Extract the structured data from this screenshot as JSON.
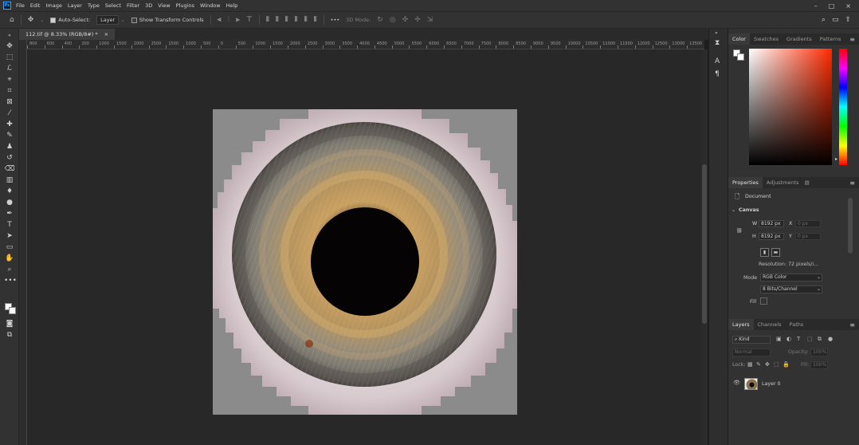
{
  "app": {
    "logo_text": "Ps"
  },
  "menu": [
    "File",
    "Edit",
    "Image",
    "Layer",
    "Type",
    "Select",
    "Filter",
    "3D",
    "View",
    "Plugins",
    "Window",
    "Help"
  ],
  "window_controls": {
    "minimize": "–",
    "maximize": "□",
    "close": "×"
  },
  "options_bar": {
    "auto_select_label": "Auto-Select:",
    "auto_select_checked": true,
    "auto_select_target": "Layer",
    "show_transform_label": "Show Transform Controls",
    "mode_3d_label": "3D Mode:",
    "more_label": "•••"
  },
  "document": {
    "tab_title": "112.tif @ 8.33% (RGB/8#) *",
    "close_glyph": "×"
  },
  "ruler": {
    "labels": [
      "800",
      "600",
      "400",
      "200",
      "1000",
      "1500",
      "2000",
      "2500",
      "1500",
      "1000",
      "500",
      "0",
      "500",
      "1000",
      "1500",
      "2000",
      "2500",
      "3000",
      "3500",
      "4000",
      "4500",
      "5000",
      "5500",
      "6000",
      "6500",
      "7000",
      "7500",
      "8000",
      "8500",
      "9000",
      "9500",
      "10000",
      "10500",
      "11000",
      "11500",
      "12000",
      "12500",
      "13000",
      "13500"
    ]
  },
  "color_panel": {
    "tabs": [
      "Color",
      "Swatches",
      "Gradients",
      "Patterns"
    ],
    "hue_base": "#ff2a00"
  },
  "properties_panel": {
    "tabs": [
      "Properties",
      "Adjustments"
    ],
    "doc_label": "Document",
    "section": "Canvas",
    "w_label": "W",
    "w_value": "8192 px",
    "h_label": "H",
    "h_value": "8192 px",
    "x_label": "X",
    "x_value": "0 px",
    "y_label": "Y",
    "y_value": "0 px",
    "resolution": "Resolution: 72 pixels/i...",
    "mode_label": "Mode",
    "mode_value": "RGB Color",
    "depth_value": "8 Bits/Channel",
    "fill_label": "Fill"
  },
  "layers_panel": {
    "tabs": [
      "Layers",
      "Channels",
      "Paths"
    ],
    "kind_label": "Kind",
    "blend_mode": "Normal",
    "opacity_label": "Opacity:",
    "opacity_value": "100%",
    "lock_label": "Lock:",
    "fill_label": "Fill:",
    "fill_value": "100%",
    "layer_name": "Layer 0"
  }
}
